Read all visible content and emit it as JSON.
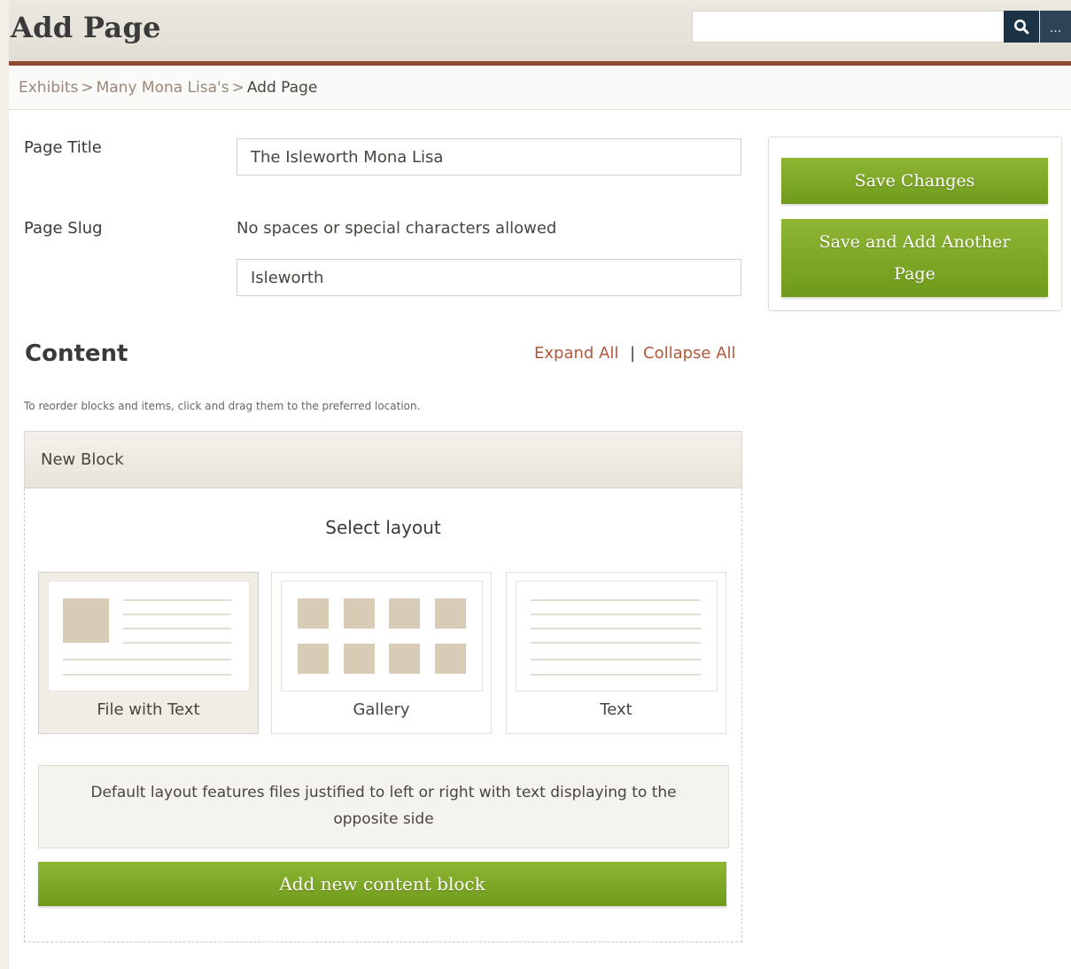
{
  "header": {
    "title": "Add Page",
    "search": {
      "value": "",
      "placeholder": ""
    },
    "search_icon": "search-icon",
    "more_label": "..."
  },
  "breadcrumb": {
    "items": [
      "Exhibits",
      "Many Mona Lisa's"
    ],
    "separator": ">",
    "current": "Add Page"
  },
  "form": {
    "page_title_label": "Page Title",
    "page_title_value": "The Isleworth Mona Lisa",
    "page_slug_label": "Page Slug",
    "page_slug_hint": "No spaces or special characters allowed",
    "page_slug_value": "Isleworth"
  },
  "actions": {
    "save_changes": "Save Changes",
    "save_and_add": "Save and Add Another Page"
  },
  "content": {
    "heading": "Content",
    "expand_all": "Expand All",
    "separator": "|",
    "collapse_all": "Collapse All",
    "reorder_hint": "To reorder blocks and items, click and drag them to the preferred location."
  },
  "block": {
    "title": "New Block",
    "select_layout": "Select layout",
    "layouts": [
      {
        "label": "File with Text",
        "selected": true
      },
      {
        "label": "Gallery",
        "selected": false
      },
      {
        "label": "Text",
        "selected": false
      }
    ],
    "description": "Default layout features files justified to left or right with text displaying to the opposite side",
    "add_block": "Add new content block"
  },
  "colors": {
    "accent_green": "#7ba626",
    "header_rule": "#8b4a31",
    "link": "#b1583a",
    "search_button": "#1c3346",
    "preview_tan": "#d8ccb6"
  }
}
